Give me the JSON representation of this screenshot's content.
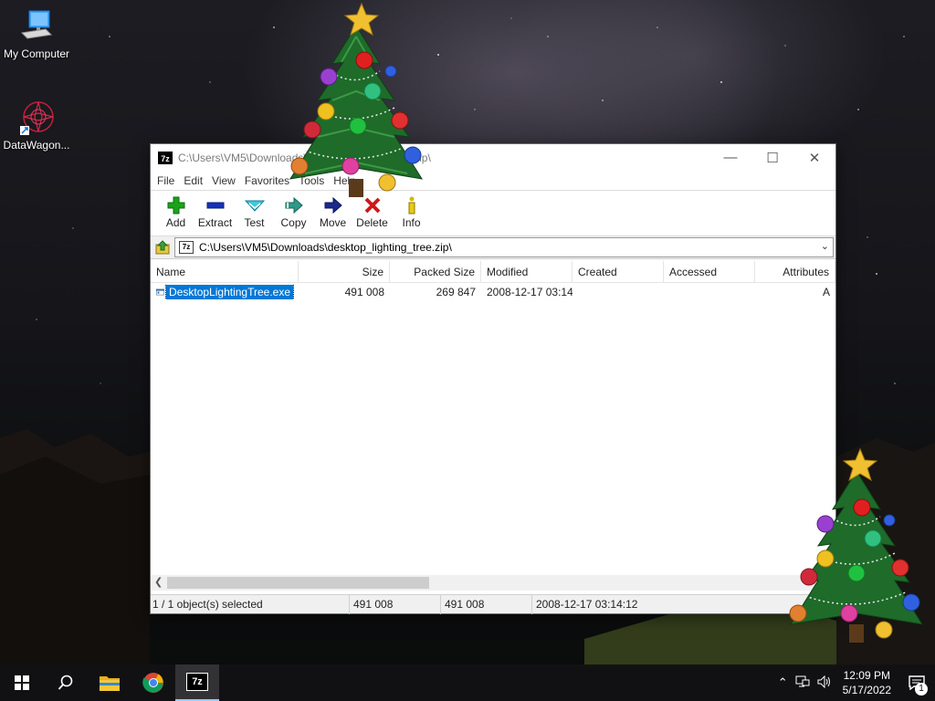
{
  "desktop": {
    "icons": [
      {
        "label": "My Computer"
      },
      {
        "label": "DataWagon..."
      }
    ]
  },
  "window": {
    "title": "C:\\Users\\VM5\\Downloads\\desktop_lighting_tree.zip\\",
    "controls": {
      "minimize": "—",
      "maximize": "☐",
      "close": "✕"
    },
    "app_icon_text": "7z",
    "menu": [
      "File",
      "Edit",
      "View",
      "Favorites",
      "Tools",
      "Help"
    ],
    "toolbar": [
      {
        "label": "Add",
        "icon": "add-icon"
      },
      {
        "label": "Extract",
        "icon": "extract-icon"
      },
      {
        "label": "Test",
        "icon": "test-icon"
      },
      {
        "label": "Copy",
        "icon": "copy-icon"
      },
      {
        "label": "Move",
        "icon": "move-icon"
      },
      {
        "label": "Delete",
        "icon": "delete-icon"
      },
      {
        "label": "Info",
        "icon": "info-icon"
      }
    ],
    "address": {
      "path": "C:\\Users\\VM5\\Downloads\\desktop_lighting_tree.zip\\"
    },
    "columns": [
      "Name",
      "Size",
      "Packed Size",
      "Modified",
      "Created",
      "Accessed",
      "Attributes"
    ],
    "files": [
      {
        "name": "DesktopLightingTree.exe",
        "size": "491 008",
        "packed": "269 847",
        "modified": "2008-12-17 03:14",
        "created": "",
        "accessed": "",
        "attributes": "A"
      }
    ],
    "status": {
      "selected": "1 / 1 object(s) selected",
      "size": "491 008",
      "packed": "491 008",
      "modified": "2008-12-17 03:14:12"
    }
  },
  "taskbar": {
    "clock_time": "12:09 PM",
    "clock_date": "5/17/2022",
    "notification_count": "1",
    "active_app_text": "7z"
  },
  "colors": {
    "selection": "#0078d7",
    "ornament_red": "#e02020",
    "tree_green": "#1f6b2a"
  }
}
